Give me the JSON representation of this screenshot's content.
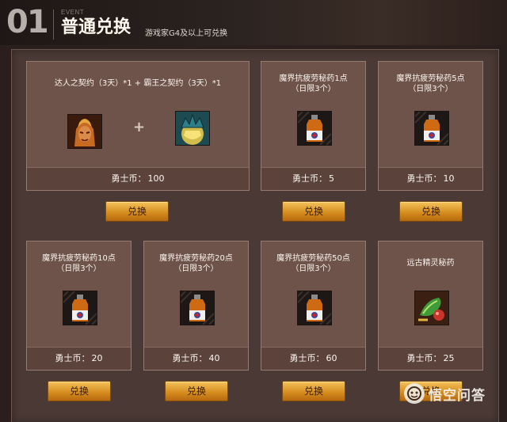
{
  "header": {
    "number": "01",
    "event_label": "EVENT",
    "title": "普通兑换",
    "subtitle": "游戏家G4及以上可兑换"
  },
  "cards": [
    {
      "title": "达人之契约（3天）*1 + 霸王之契约（3天）*1",
      "title_line2": "",
      "icons": [
        "warrior-portrait-icon",
        "crown-icon"
      ],
      "currency_label": "勇士币：",
      "price": "100",
      "button_label": "兑换"
    },
    {
      "title": "魔界抗疲劳秘药1点",
      "title_line2": "（日限3个）",
      "icons": [
        "potion-bottle-icon"
      ],
      "currency_label": "勇士币：",
      "price": "5",
      "button_label": "兑换"
    },
    {
      "title": "魔界抗疲劳秘药5点",
      "title_line2": "（日限3个）",
      "icons": [
        "potion-bottle-icon"
      ],
      "currency_label": "勇士币：",
      "price": "10",
      "button_label": "兑换"
    },
    {
      "title": "魔界抗疲劳秘药10点",
      "title_line2": "（日限3个）",
      "icons": [
        "potion-bottle-icon"
      ],
      "currency_label": "勇士币：",
      "price": "20",
      "button_label": "兑换"
    },
    {
      "title": "魔界抗疲劳秘药20点",
      "title_line2": "（日限3个）",
      "icons": [
        "potion-bottle-icon"
      ],
      "currency_label": "勇士币：",
      "price": "40",
      "button_label": "兑换"
    },
    {
      "title": "魔界抗疲劳秘药50点",
      "title_line2": "（日限3个）",
      "icons": [
        "potion-bottle-icon"
      ],
      "currency_label": "勇士币：",
      "price": "60",
      "button_label": "兑换"
    },
    {
      "title": "远古精灵秘药",
      "title_line2": "",
      "icons": [
        "elf-potion-icon"
      ],
      "currency_label": "勇士币：",
      "price": "25",
      "button_label": "兑换"
    }
  ],
  "watermark": {
    "text": "悟空问答"
  },
  "colors": {
    "background": "#2a1f1c",
    "card": "#6e534a",
    "button": "#e3a536",
    "title_text": "#fff7ee"
  }
}
